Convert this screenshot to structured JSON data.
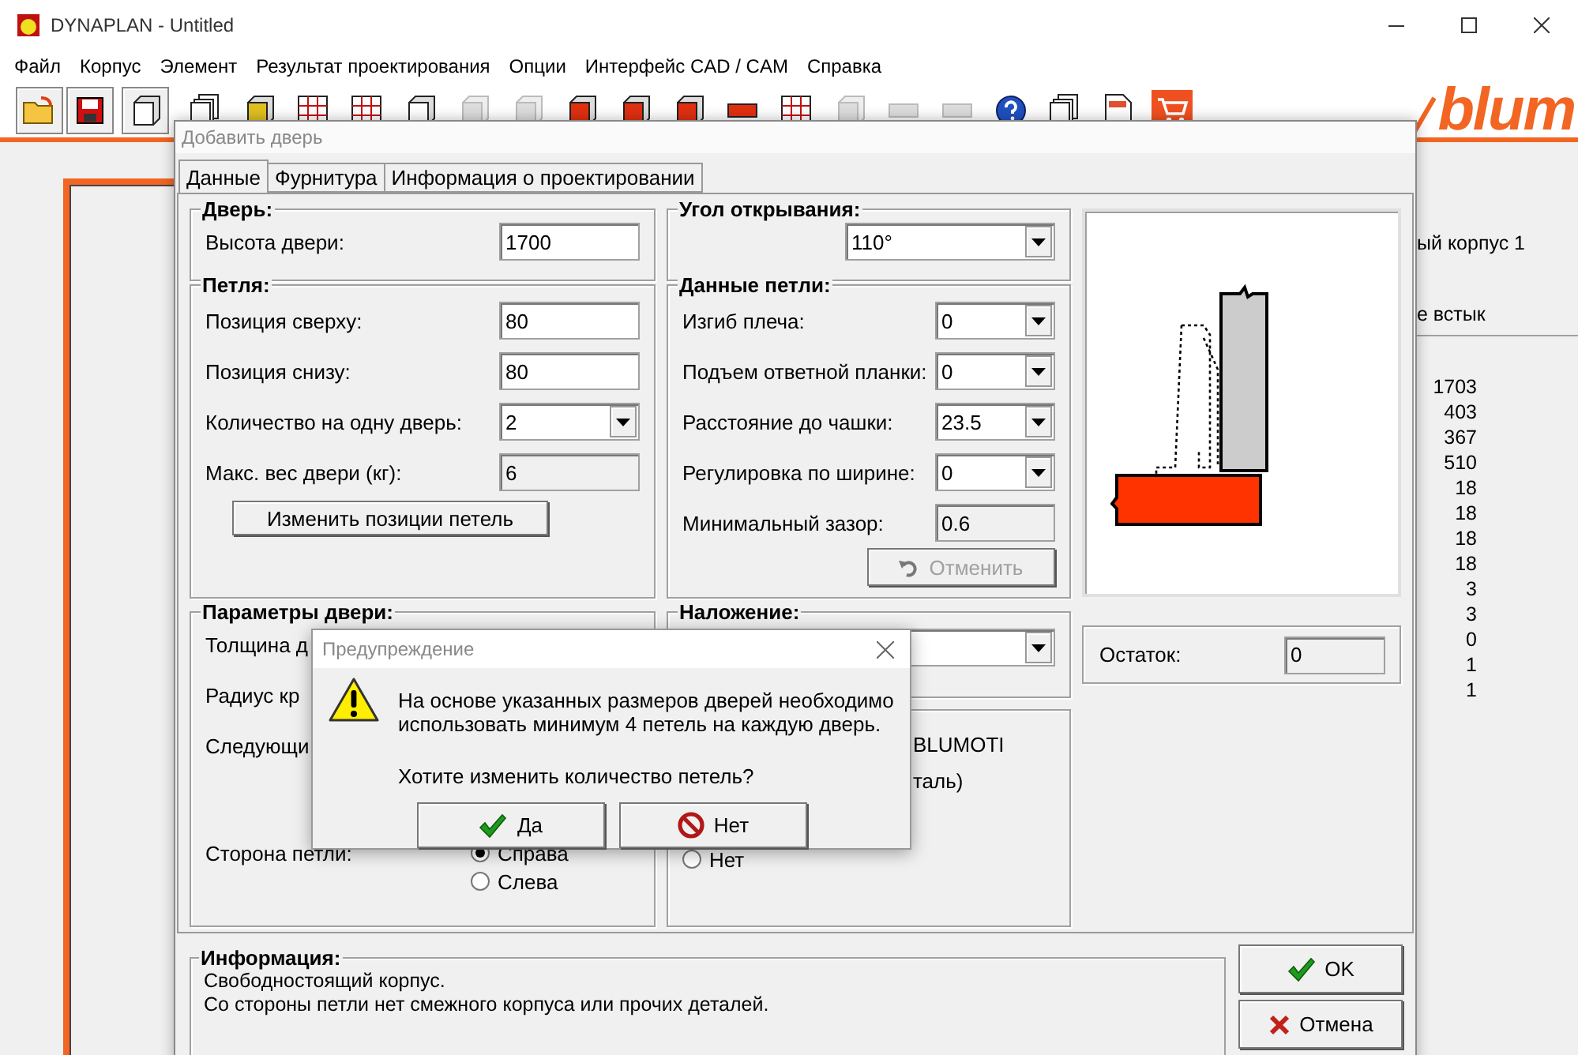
{
  "window": {
    "title": "DYNAPLAN - Untitled"
  },
  "menu": [
    "Файл",
    "Корпус",
    "Элемент",
    "Результат проектирования",
    "Опции",
    "Интерфейс CAD / CAM",
    "Справка"
  ],
  "logo": "blum",
  "background": {
    "title_fragment": "ый корпус 1",
    "joint_fragment": "е встык",
    "values": [
      "1703",
      "403",
      "367",
      "510",
      "18",
      "18",
      "18",
      "18",
      "3",
      "3",
      "0",
      "1",
      "1"
    ]
  },
  "dialog": {
    "title": "Добавить дверь",
    "tabs": [
      {
        "label": "Данные",
        "selected": true
      },
      {
        "label": "Фурнитура",
        "selected": false
      },
      {
        "label": "Информация о проектировании",
        "selected": false
      }
    ],
    "door": {
      "title": "Дверь:",
      "fields": [
        {
          "label": "Высота двери:",
          "value": "1700",
          "kind": "input"
        }
      ]
    },
    "hinge": {
      "title": "Петля:",
      "fields": [
        {
          "label": "Позиция сверху:",
          "value": "80",
          "kind": "input"
        },
        {
          "label": "Позиция снизу:",
          "value": "80",
          "kind": "input"
        },
        {
          "label": "Количество на одну дверь:",
          "value": "2",
          "kind": "select"
        },
        {
          "label": "Макс. вес двери (кг):",
          "value": "6",
          "kind": "readonly"
        }
      ],
      "button": "Изменить позиции петель"
    },
    "angle": {
      "title": "Угол открывания:",
      "value": "110°"
    },
    "hinge_data": {
      "title": "Данные петли:",
      "fields": [
        {
          "label": "Изгиб плеча:",
          "value": "0",
          "kind": "select"
        },
        {
          "label": "Подъем ответной планки:",
          "value": "0",
          "kind": "select"
        },
        {
          "label": "Расстояние до чашки:",
          "value": "23.5",
          "kind": "select"
        },
        {
          "label": "Регулировка по ширине:",
          "value": "0",
          "kind": "select"
        },
        {
          "label": "Минимальный зазор:",
          "value": "0.6",
          "kind": "readonly"
        }
      ],
      "undo": {
        "label": "Отменить",
        "disabled": true
      }
    },
    "remainder": {
      "label": "Остаток:",
      "value": "0"
    },
    "door_params": {
      "title": "Параметры двери:",
      "labels": [
        "Толщина д",
        "Радиус кр",
        "Следующи"
      ],
      "side": {
        "label": "Сторона петли:",
        "options": [
          {
            "label": "Справа",
            "selected": true
          },
          {
            "label": "Слева",
            "selected": false
          }
        ]
      }
    },
    "overlay": {
      "title": "Наложение:"
    },
    "options": {
      "fragments": [
        "BLUMOTI",
        "таль)"
      ],
      "option": {
        "label": "Нет",
        "selected": false
      }
    },
    "info": {
      "title": "Информация:",
      "lines": [
        "Свободностоящий корпус.",
        "Со стороны петли нет смежного корпуса или прочих деталей."
      ]
    },
    "buttons": [
      {
        "label": "OK",
        "kind": "ok"
      },
      {
        "label": "Отмена",
        "kind": "cancel"
      }
    ]
  },
  "warning": {
    "title": "Предупреждение",
    "message": [
      "На основе указанных размеров дверей необходимо",
      "использовать минимум 4 петель на каждую дверь."
    ],
    "question": "Хотите изменить количество петель?",
    "buttons": [
      {
        "label": "Да",
        "kind": "yes"
      },
      {
        "label": "Нет",
        "kind": "no"
      }
    ]
  }
}
